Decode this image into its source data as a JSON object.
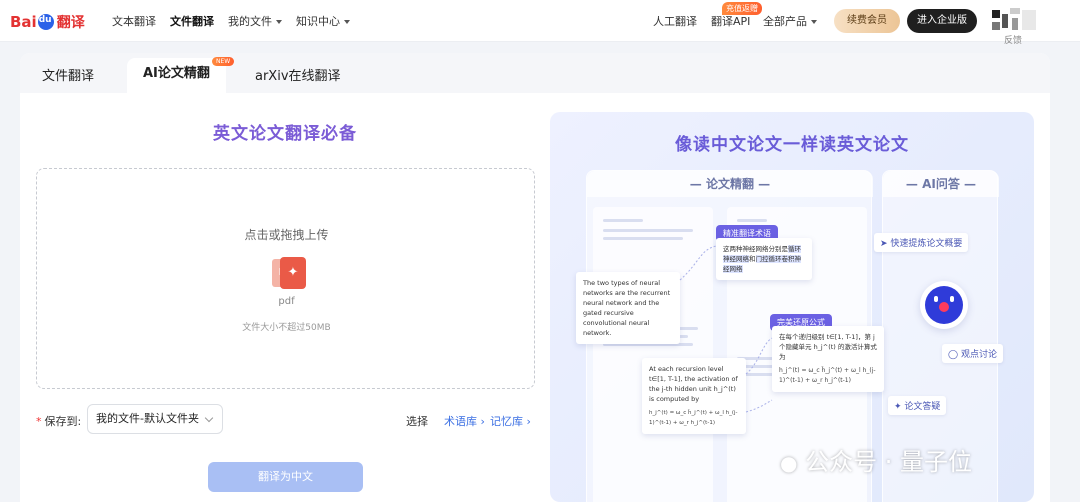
{
  "brand": {
    "logo_part1": "Bai",
    "logo_part2": "翻译"
  },
  "nav": {
    "text_translate": "文本翻译",
    "file_translate": "文件翻译",
    "my_files": "我的文件",
    "knowledge": "知识中心",
    "human_translate": "人工翻译",
    "api": "翻译API",
    "api_badge": "充值返赠",
    "all_products": "全部产品",
    "vip_button": "续费会员",
    "enterprise_button": "进入企业版",
    "feedback": "反馈"
  },
  "tabs": [
    {
      "label": "文件翻译"
    },
    {
      "label": "AI论文精翻",
      "badge": "NEW"
    },
    {
      "label": "arXiv在线翻译"
    }
  ],
  "upload": {
    "title": "英文论文翻译必备",
    "prompt": "点击或拖拽上传",
    "file_type": "pdf",
    "size_limit": "文件大小不超过50MB"
  },
  "save": {
    "label": "保存到:",
    "value": "我的文件-默认文件夹",
    "select_text": "选择",
    "glossary_link": "术语库",
    "memory_link": "记忆库",
    "translate_button": "翻译为中文"
  },
  "promo": {
    "title": "像读中文论文一样读英文论文",
    "panel_paper": "论文精翻",
    "panel_ai": "AI问答",
    "pill_terms": "精准翻译术语",
    "pill_formula": "完美还原公式",
    "zh_note_1a": "这两种神经网络分别是",
    "zh_note_1b": "循环神经网络",
    "zh_note_1c": "和",
    "zh_note_1d": "门控循",
    "zh_note_1e": "环卷积神经网络",
    "en_note_1": "The two types of neural networks are the recurrent neural network and the gated recursive convolutional neural network.",
    "zh_note_2": "在每个递归级别 t∈[1, T-1]，第 j 个隐藏单元 h_j^(t) 的激活计算式为",
    "en_note_2": "At each recursion level t∈[1, T-1], the activation of the j-th hidden unit h_j^(t) is computed by",
    "formula": "h_j^(t) = ω_c h̃_j^(t) + ω_l h_(j-1)^(t-1) + ω_r h_j^(t-1)",
    "chip_summary": "快速提炼论文概要",
    "chip_discuss": "观点讨论",
    "chip_qa": "论文答疑"
  },
  "watermark": "公众号 · 量子位"
}
